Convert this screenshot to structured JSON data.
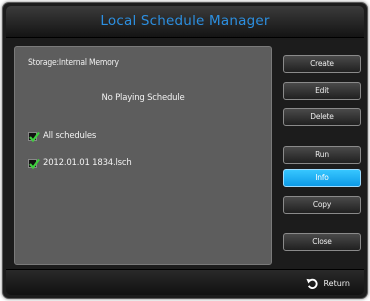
{
  "window": {
    "title": "Local Schedule Manager"
  },
  "panel": {
    "storage_label": "Storage:Internal Memory",
    "status_text": "No Playing Schedule",
    "items": [
      {
        "label": "All schedules",
        "checked": true
      },
      {
        "label": "2012.01.01 1834.lsch",
        "checked": true
      }
    ]
  },
  "buttons": {
    "create": "Create",
    "edit": "Edit",
    "delete": "Delete",
    "run": "Run",
    "info": "Info",
    "copy": "Copy",
    "close": "Close"
  },
  "footer": {
    "return_label": "Return"
  },
  "colors": {
    "title": "#2c8fe0",
    "active_button": "#1aaeff",
    "check": "#3ecf3e"
  }
}
